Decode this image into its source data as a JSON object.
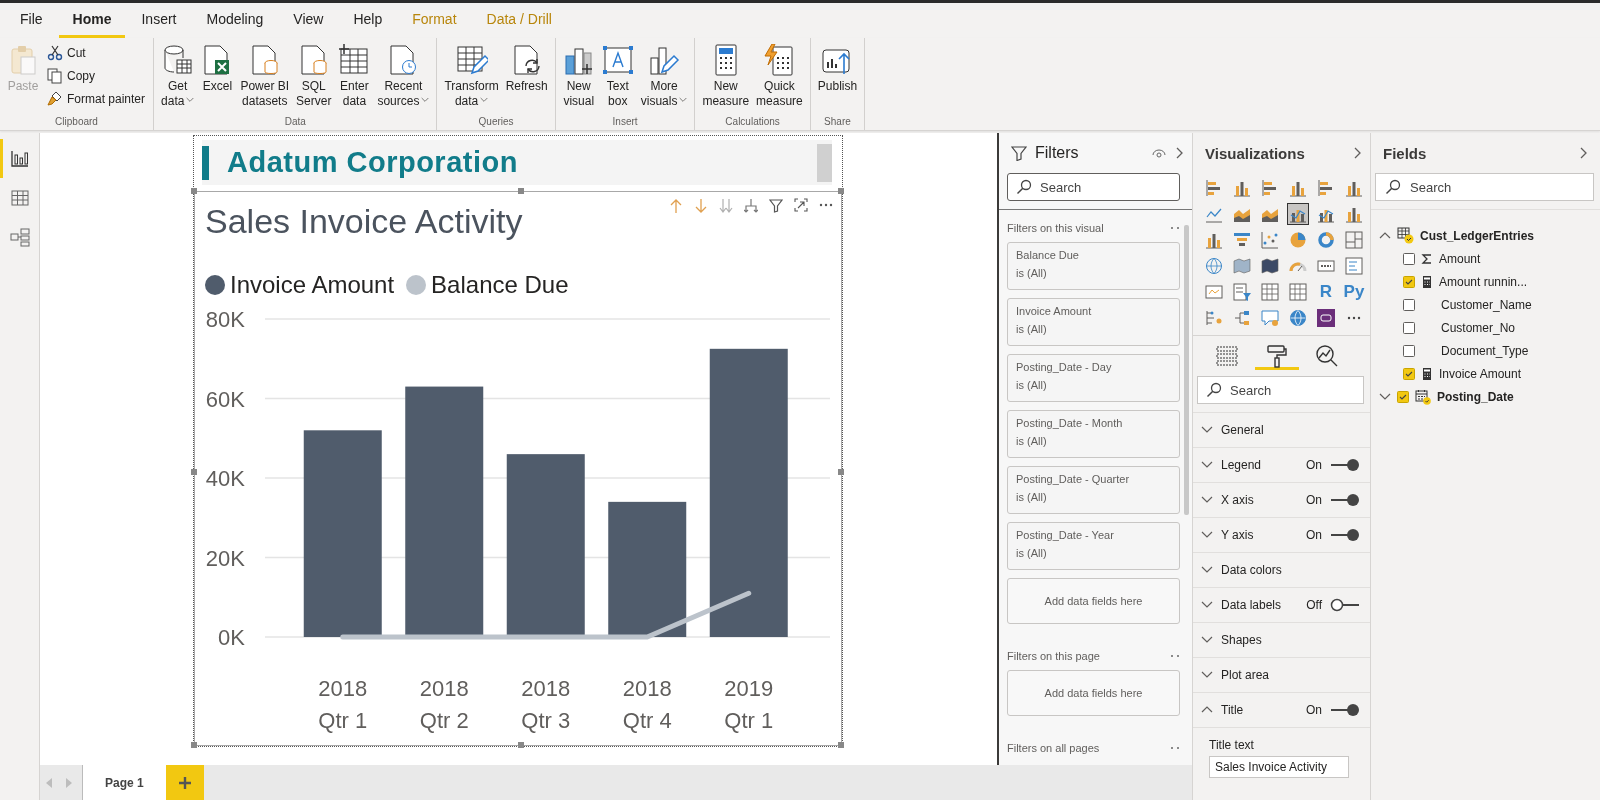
{
  "menu_tabs": [
    {
      "label": "File",
      "selected": false,
      "contextual": false
    },
    {
      "label": "Home",
      "selected": true,
      "contextual": false
    },
    {
      "label": "Insert",
      "selected": false,
      "contextual": false
    },
    {
      "label": "Modeling",
      "selected": false,
      "contextual": false
    },
    {
      "label": "View",
      "selected": false,
      "contextual": false
    },
    {
      "label": "Help",
      "selected": false,
      "contextual": false
    },
    {
      "label": "Format",
      "selected": false,
      "contextual": true
    },
    {
      "label": "Data / Drill",
      "selected": false,
      "contextual": true
    }
  ],
  "ribbon": {
    "groups": [
      {
        "name": "Clipboard",
        "buttons": [
          {
            "lines": [
              "Paste"
            ],
            "disabled": true
          }
        ],
        "small_buttons": [
          {
            "label": "Cut"
          },
          {
            "label": "Copy"
          },
          {
            "label": "Format painter"
          }
        ]
      },
      {
        "name": "Data",
        "buttons": [
          {
            "lines": [
              "Get",
              "data"
            ],
            "has_menu": true
          },
          {
            "lines": [
              "Excel"
            ]
          },
          {
            "lines": [
              "Power BI",
              "datasets"
            ]
          },
          {
            "lines": [
              "SQL",
              "Server"
            ]
          },
          {
            "lines": [
              "Enter",
              "data"
            ]
          },
          {
            "lines": [
              "Recent",
              "sources"
            ],
            "has_menu": true
          }
        ]
      },
      {
        "name": "Queries",
        "buttons": [
          {
            "lines": [
              "Transform",
              "data"
            ],
            "has_menu": true
          },
          {
            "lines": [
              "Refresh"
            ]
          }
        ]
      },
      {
        "name": "Insert",
        "buttons": [
          {
            "lines": [
              "New",
              "visual"
            ]
          },
          {
            "lines": [
              "Text",
              "box"
            ]
          },
          {
            "lines": [
              "More",
              "visuals"
            ],
            "has_menu": true
          }
        ]
      },
      {
        "name": "Calculations",
        "buttons": [
          {
            "lines": [
              "New",
              "measure"
            ]
          },
          {
            "lines": [
              "Quick",
              "measure"
            ]
          }
        ]
      },
      {
        "name": "Share",
        "buttons": [
          {
            "lines": [
              "Publish"
            ]
          }
        ]
      }
    ]
  },
  "views": [
    {
      "selected": true
    },
    {
      "selected": false
    },
    {
      "selected": false
    }
  ],
  "report": {
    "heading": "Adatum Corporation",
    "visual": {
      "title": "Sales Invoice Activity",
      "selected": true,
      "chart_data": {
        "type": "bar",
        "categories": [
          "2018 Qtr 1",
          "2018 Qtr 2",
          "2018 Qtr 3",
          "2018 Qtr 4",
          "2019 Qtr 1"
        ],
        "series": [
          {
            "name": "Invoice Amount",
            "color": "#505c6c",
            "type": "bar",
            "values": [
              52000,
              63000,
              46000,
              34000,
              72500
            ]
          },
          {
            "name": "Balance Due",
            "color": "#bcc3cb",
            "type": "line",
            "values": [
              0,
              0,
              0,
              0,
              11000
            ]
          }
        ],
        "ylim": [
          0,
          80000
        ],
        "grid": true,
        "yticks": [
          {
            "value": 0,
            "label": "0K"
          },
          {
            "value": 20000,
            "label": "20K"
          },
          {
            "value": 40000,
            "label": "40K"
          },
          {
            "value": 60000,
            "label": "60K"
          },
          {
            "value": 80000,
            "label": "80K"
          }
        ]
      }
    }
  },
  "pages": [
    {
      "label": "Page 1",
      "selected": true
    }
  ],
  "filters": {
    "title": "Filters",
    "search_placeholder": "Search",
    "sections": [
      {
        "title": "Filters on this visual",
        "cards": [
          {
            "field": "Balance Due",
            "condition": "is (All)"
          },
          {
            "field": "Invoice Amount",
            "condition": "is (All)"
          },
          {
            "field": "Posting_Date - Day",
            "condition": "is (All)"
          },
          {
            "field": "Posting_Date - Month",
            "condition": "is (All)"
          },
          {
            "field": "Posting_Date - Quarter",
            "condition": "is (All)"
          },
          {
            "field": "Posting_Date - Year",
            "condition": "is (All)"
          }
        ],
        "drop_zone": "Add data fields here"
      },
      {
        "title": "Filters on this page",
        "drop_zone": "Add data fields here"
      },
      {
        "title": "Filters on all pages"
      }
    ]
  },
  "visualizations": {
    "title": "Visualizations",
    "gallery": [
      {
        "kind": "stacked-bar",
        "selected": false
      },
      {
        "kind": "stacked-column",
        "selected": false
      },
      {
        "kind": "clustered-bar",
        "selected": false
      },
      {
        "kind": "clustered-column",
        "selected": false
      },
      {
        "kind": "percent-bar",
        "selected": false
      },
      {
        "kind": "percent-column",
        "selected": false
      },
      {
        "kind": "line",
        "selected": false
      },
      {
        "kind": "area",
        "selected": false
      },
      {
        "kind": "stacked-area",
        "selected": false
      },
      {
        "kind": "line-column",
        "selected": true
      },
      {
        "kind": "line-stacked-column",
        "selected": false
      },
      {
        "kind": "ribbon",
        "selected": false
      },
      {
        "kind": "waterfall",
        "selected": false
      },
      {
        "kind": "funnel",
        "selected": false
      },
      {
        "kind": "scatter",
        "selected": false
      },
      {
        "kind": "pie",
        "selected": false
      },
      {
        "kind": "donut",
        "selected": false
      },
      {
        "kind": "treemap",
        "selected": false
      },
      {
        "kind": "map",
        "selected": false
      },
      {
        "kind": "filled-map",
        "selected": false
      },
      {
        "kind": "shape-map",
        "selected": false
      },
      {
        "kind": "gauge",
        "selected": false
      },
      {
        "kind": "card",
        "selected": false
      },
      {
        "kind": "multirow-card",
        "selected": false
      },
      {
        "kind": "kpi",
        "selected": false
      },
      {
        "kind": "slicer",
        "selected": false
      },
      {
        "kind": "table",
        "selected": false
      },
      {
        "kind": "matrix",
        "selected": false
      },
      {
        "kind": "script",
        "label": "R",
        "selected": false
      },
      {
        "kind": "script",
        "label": "Py",
        "selected": false
      },
      {
        "kind": "key-influencers",
        "selected": false
      },
      {
        "kind": "decomposition-tree",
        "selected": false
      },
      {
        "kind": "qa",
        "selected": false
      },
      {
        "kind": "globe",
        "selected": false
      },
      {
        "kind": "custom",
        "selected": false
      }
    ],
    "format_tabs": [
      {
        "selected": false
      },
      {
        "selected": true
      },
      {
        "selected": false
      }
    ],
    "search_placeholder": "Search",
    "cards": [
      {
        "label": "General",
        "expanded": false
      },
      {
        "label": "Legend",
        "expanded": false,
        "toggle": "On",
        "on": true
      },
      {
        "label": "X axis",
        "expanded": false,
        "toggle": "On",
        "on": true
      },
      {
        "label": "Y axis",
        "expanded": false,
        "toggle": "On",
        "on": true
      },
      {
        "label": "Data colors",
        "expanded": false
      },
      {
        "label": "Data labels",
        "expanded": false,
        "toggle": "Off",
        "on": false
      },
      {
        "label": "Shapes",
        "expanded": false
      },
      {
        "label": "Plot area",
        "expanded": false
      },
      {
        "label": "Title",
        "expanded": true,
        "toggle": "On",
        "on": true
      }
    ],
    "title_text": {
      "label": "Title text",
      "value": "Sales Invoice Activity"
    }
  },
  "fields": {
    "title": "Fields",
    "search_placeholder": "Search",
    "tables": [
      {
        "name": "Cust_LedgerEntries",
        "expanded": true,
        "children": [
          {
            "name": "Amount",
            "kind": "sum",
            "checked": false
          },
          {
            "name": "Amount runnin...",
            "kind": "measure",
            "checked": true
          },
          {
            "name": "Customer_Name",
            "kind": "column",
            "checked": false
          },
          {
            "name": "Customer_No",
            "kind": "column",
            "checked": false
          },
          {
            "name": "Document_Type",
            "kind": "column",
            "checked": false
          },
          {
            "name": "Invoice Amount",
            "kind": "measure",
            "checked": true
          },
          {
            "name": "Posting_Date",
            "kind": "date",
            "checked": true,
            "expanded": false
          }
        ]
      }
    ]
  }
}
